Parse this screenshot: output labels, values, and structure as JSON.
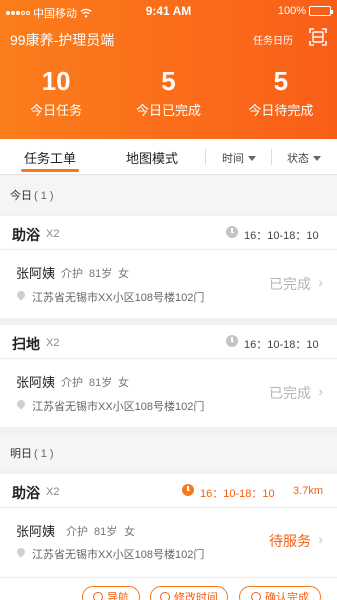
{
  "status_bar": {
    "carrier": "中国移动",
    "time": "9:41 AM",
    "battery": "100%",
    "battery_level": 1.0
  },
  "header": {
    "title": "99康养-护理员端",
    "calendar_label": "任务日历",
    "scan_icon": "scan-icon"
  },
  "stats": [
    {
      "value": "10",
      "label": "今日任务"
    },
    {
      "value": "5",
      "label": "今日已完成"
    },
    {
      "value": "5",
      "label": "今日待完成"
    }
  ],
  "tabs": {
    "task_list": "任务工单",
    "map_mode": "地图模式",
    "time_filter": "时间",
    "status_filter": "状态"
  },
  "sections": {
    "today": {
      "label": "今日",
      "count": "( 1 )"
    },
    "tomorrow": {
      "label": "明日",
      "count": "( 1 )"
    }
  },
  "tasks": [
    {
      "name": "助浴",
      "count": "X2",
      "time": "16：10-18：10",
      "client": "张阿姨",
      "role": "介护",
      "age": "81岁",
      "gender": "女",
      "address": "江苏省无锡市XX小区108号楼102门",
      "status": "已完成"
    },
    {
      "name": "扫地",
      "count": "X2",
      "time": "16：10-18：10",
      "client": "张阿姨",
      "role": "介护",
      "age": "81岁",
      "gender": "女",
      "address": "江苏省无锡市XX小区108号楼102门",
      "status": "已完成"
    },
    {
      "name": "助浴",
      "count": "X2",
      "time": "16：10-18：10",
      "distance": "3.7km",
      "client": "张阿姨",
      "role": "介护",
      "age": "81岁",
      "gender": "女",
      "address": "江苏省无锡市XX小区108号楼102门",
      "status": "待服务"
    }
  ],
  "actions": {
    "navigate": "导航",
    "change_time": "修改时间",
    "confirm": "确认完成"
  },
  "colors": {
    "accent": "#f7791d",
    "header_start": "#fb7d1b",
    "header_end": "#f95e19",
    "pending": "#f35f14",
    "done": "#b5b5b5"
  }
}
